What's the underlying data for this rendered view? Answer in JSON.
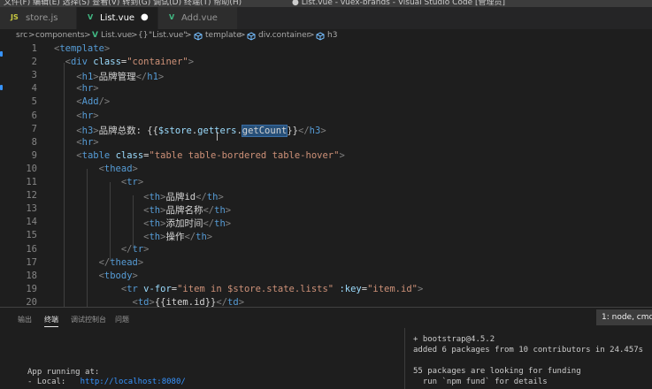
{
  "titlebar": {
    "menu_left": "文件(F)   编辑(E)   选择(S)   查看(V)   转到(G)   调试(D)   终端(T)   帮助(H)",
    "window_title": "● List.vue - vuex-brands - Visual Studio Code [管理员]"
  },
  "tabs": [
    {
      "icon": "JS",
      "label": "store.js",
      "active": false
    },
    {
      "icon": "V",
      "label": "List.vue",
      "active": true,
      "modified": "●"
    },
    {
      "icon": "V",
      "label": "Add.vue",
      "active": false
    }
  ],
  "breadcrumb": {
    "items": [
      "src",
      "components",
      "List.vue",
      "\"List.vue\"",
      "template",
      "div.container",
      "h3"
    ],
    "separator": ">",
    "braces": "{}"
  },
  "editor": {
    "line_numbers": [
      "1",
      "2",
      "3",
      "4",
      "5",
      "6",
      "7",
      "8",
      "9",
      "10",
      "11",
      "12",
      "13",
      "14",
      "15",
      "16",
      "17",
      "18",
      "19",
      "20"
    ],
    "lines": [
      {
        "indent": "",
        "parts": [
          [
            "punc",
            "<"
          ],
          [
            "tag",
            "template"
          ],
          [
            "punc",
            ">"
          ]
        ]
      },
      {
        "indent": "  ",
        "parts": [
          [
            "punc",
            "<"
          ],
          [
            "tag",
            "div"
          ],
          [
            "txt",
            " "
          ],
          [
            "attr",
            "class"
          ],
          [
            "txt",
            "="
          ],
          [
            "str",
            "\"container\""
          ],
          [
            "punc",
            ">"
          ]
        ]
      },
      {
        "indent": "    ",
        "parts": [
          [
            "punc",
            "<"
          ],
          [
            "tag",
            "h1"
          ],
          [
            "punc",
            ">"
          ],
          [
            "txt",
            "品牌管理"
          ],
          [
            "punc",
            "</"
          ],
          [
            "tag",
            "h1"
          ],
          [
            "punc",
            ">"
          ]
        ]
      },
      {
        "indent": "    ",
        "parts": [
          [
            "punc",
            "<"
          ],
          [
            "tag",
            "hr"
          ],
          [
            "punc",
            ">"
          ]
        ]
      },
      {
        "indent": "    ",
        "parts": [
          [
            "punc",
            "<"
          ],
          [
            "tag",
            "Add"
          ],
          [
            "punc",
            "/>"
          ]
        ]
      },
      {
        "indent": "    ",
        "parts": [
          [
            "punc",
            "<"
          ],
          [
            "tag",
            "hr"
          ],
          [
            "punc",
            ">"
          ]
        ]
      },
      {
        "indent": "    ",
        "parts": [
          [
            "punc",
            "<"
          ],
          [
            "tag",
            "h3"
          ],
          [
            "punc",
            ">"
          ],
          [
            "txt",
            "品牌总数: {{"
          ],
          [
            "var",
            "$store"
          ],
          [
            "txt",
            "."
          ],
          [
            "var",
            "getters"
          ],
          [
            "txt",
            "."
          ],
          [
            "hl",
            "getCount"
          ],
          [
            "txt",
            "}}"
          ],
          [
            "punc",
            "</"
          ],
          [
            "tag",
            "h3"
          ],
          [
            "punc",
            ">"
          ]
        ]
      },
      {
        "indent": "    ",
        "parts": [
          [
            "punc",
            "<"
          ],
          [
            "tag",
            "hr"
          ],
          [
            "punc",
            ">"
          ]
        ]
      },
      {
        "indent": "    ",
        "parts": [
          [
            "punc",
            "<"
          ],
          [
            "tag",
            "table"
          ],
          [
            "txt",
            " "
          ],
          [
            "attr",
            "class"
          ],
          [
            "txt",
            "="
          ],
          [
            "str",
            "\"table table-bordered table-hover\""
          ],
          [
            "punc",
            ">"
          ]
        ]
      },
      {
        "indent": "        ",
        "parts": [
          [
            "punc",
            "<"
          ],
          [
            "tag",
            "thead"
          ],
          [
            "punc",
            ">"
          ]
        ]
      },
      {
        "indent": "            ",
        "parts": [
          [
            "punc",
            "<"
          ],
          [
            "tag",
            "tr"
          ],
          [
            "punc",
            ">"
          ]
        ]
      },
      {
        "indent": "                ",
        "parts": [
          [
            "punc",
            "<"
          ],
          [
            "tag",
            "th"
          ],
          [
            "punc",
            ">"
          ],
          [
            "txt",
            "品牌id"
          ],
          [
            "punc",
            "</"
          ],
          [
            "tag",
            "th"
          ],
          [
            "punc",
            ">"
          ]
        ]
      },
      {
        "indent": "                ",
        "parts": [
          [
            "punc",
            "<"
          ],
          [
            "tag",
            "th"
          ],
          [
            "punc",
            ">"
          ],
          [
            "txt",
            "品牌名称"
          ],
          [
            "punc",
            "</"
          ],
          [
            "tag",
            "th"
          ],
          [
            "punc",
            ">"
          ]
        ]
      },
      {
        "indent": "                ",
        "parts": [
          [
            "punc",
            "<"
          ],
          [
            "tag",
            "th"
          ],
          [
            "punc",
            ">"
          ],
          [
            "txt",
            "添加时间"
          ],
          [
            "punc",
            "</"
          ],
          [
            "tag",
            "th"
          ],
          [
            "punc",
            ">"
          ]
        ]
      },
      {
        "indent": "                ",
        "parts": [
          [
            "punc",
            "<"
          ],
          [
            "tag",
            "th"
          ],
          [
            "punc",
            ">"
          ],
          [
            "txt",
            "操作"
          ],
          [
            "punc",
            "</"
          ],
          [
            "tag",
            "th"
          ],
          [
            "punc",
            ">"
          ]
        ]
      },
      {
        "indent": "            ",
        "parts": [
          [
            "punc",
            "</"
          ],
          [
            "tag",
            "tr"
          ],
          [
            "punc",
            ">"
          ]
        ]
      },
      {
        "indent": "        ",
        "parts": [
          [
            "punc",
            "</"
          ],
          [
            "tag",
            "thead"
          ],
          [
            "punc",
            ">"
          ]
        ]
      },
      {
        "indent": "        ",
        "parts": [
          [
            "punc",
            "<"
          ],
          [
            "tag",
            "tbody"
          ],
          [
            "punc",
            ">"
          ]
        ]
      },
      {
        "indent": "            ",
        "parts": [
          [
            "punc",
            "<"
          ],
          [
            "tag",
            "tr"
          ],
          [
            "txt",
            " "
          ],
          [
            "attr",
            "v-for"
          ],
          [
            "txt",
            "="
          ],
          [
            "str",
            "\"item in $store.state.lists\""
          ],
          [
            "txt",
            " "
          ],
          [
            "attr",
            ":key"
          ],
          [
            "txt",
            "="
          ],
          [
            "str",
            "\"item.id\""
          ],
          [
            "punc",
            ">"
          ]
        ]
      },
      {
        "indent": "              ",
        "parts": [
          [
            "punc",
            "<"
          ],
          [
            "tag",
            "td"
          ],
          [
            "punc",
            ">"
          ],
          [
            "txt",
            "{{item.id}}"
          ],
          [
            "punc",
            "</"
          ],
          [
            "tag",
            "td"
          ],
          [
            "punc",
            ">"
          ]
        ]
      }
    ]
  },
  "panel": {
    "tabs": [
      "输出",
      "终端",
      "调试控制台",
      "问题"
    ],
    "active_tab": "终端",
    "terminal_select": "1: node, cmd"
  },
  "terminal": {
    "left_lines": [
      {
        "text": "App running at:"
      },
      {
        "prefix": "- Local:   ",
        "link": "http://localhost:8080/"
      }
    ],
    "right_lines": [
      "+ bootstrap@4.5.2",
      "added 6 packages from 10 contributors in 24.457s",
      "",
      "55 packages are looking for funding",
      "  run `npm fund` for details"
    ]
  },
  "colors": {
    "editor_bg": "#1e1e1e",
    "tag": "#569cd6",
    "attribute": "#9cdcfe",
    "string": "#ce9178",
    "link": "#3794ff"
  }
}
